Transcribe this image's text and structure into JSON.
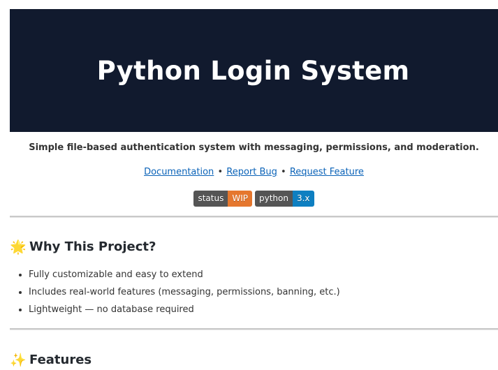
{
  "banner": {
    "title": "Python Login System",
    "background": "#111a2e"
  },
  "tagline": "Simple file-based authentication system with messaging, permissions, and moderation.",
  "links": [
    {
      "label": "Documentation"
    },
    {
      "label": "Report Bug"
    },
    {
      "label": "Request Feature"
    }
  ],
  "link_separator": "•",
  "badges": [
    {
      "key": "status",
      "value": "WIP",
      "color": "#e5772e"
    },
    {
      "key": "python",
      "value": "3.x",
      "color": "#0e7fc1"
    }
  ],
  "sections": [
    {
      "icon": "glowing-star-icon",
      "emoji": "🌟",
      "heading": "Why This Project?",
      "items": [
        "Fully customizable and easy to extend",
        "Includes real-world features (messaging, permissions, banning, etc.)",
        "Lightweight — no database required"
      ]
    },
    {
      "icon": "sparkles-icon",
      "emoji": "✨",
      "heading": "Features"
    }
  ]
}
